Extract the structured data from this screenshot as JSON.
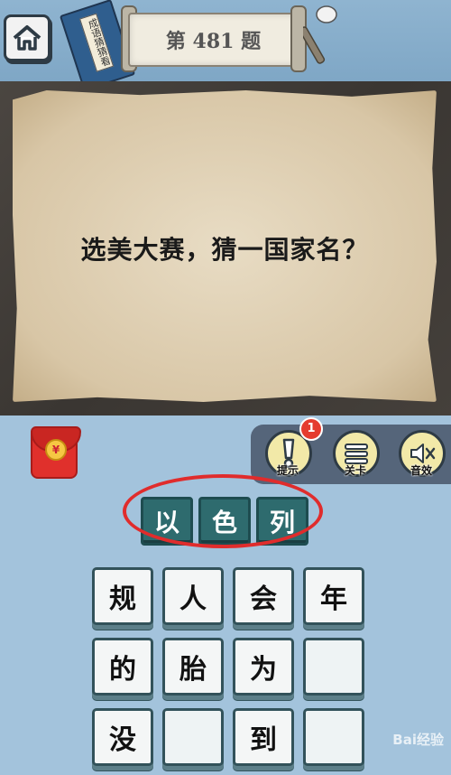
{
  "header": {
    "level_title": "第 481 题",
    "book_label": "成语猜猜看"
  },
  "question": {
    "text": "选美大赛，猜一国家名？"
  },
  "tools": {
    "hint": {
      "label": "提示",
      "badge": "1"
    },
    "levels": {
      "label": "关卡"
    },
    "sound": {
      "label": "音效"
    }
  },
  "redpacket": {
    "symbol": "¥"
  },
  "answer": [
    "以",
    "色",
    "列"
  ],
  "candidates": [
    [
      "规",
      "人",
      "会",
      "年"
    ],
    [
      "的",
      "胎",
      "为",
      ""
    ],
    [
      "没",
      "",
      "到",
      ""
    ]
  ],
  "watermark": "Bai经验"
}
